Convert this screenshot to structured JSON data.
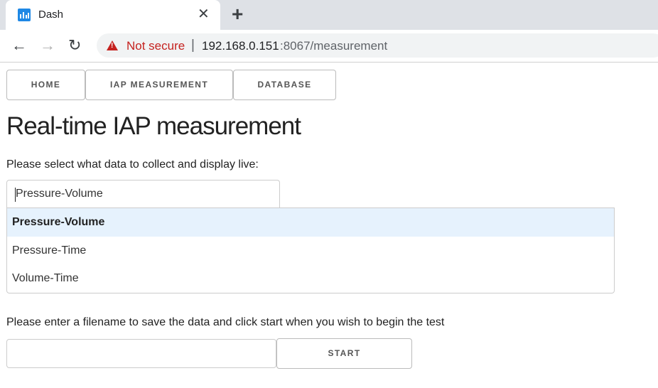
{
  "browser": {
    "tab_title": "Dash",
    "tab_close": "✕",
    "new_tab": "+",
    "security_label": "Not secure",
    "url_separator": "|",
    "url_host": "192.168.0.151",
    "url_rest": ":8067/measurement"
  },
  "nav": {
    "home": "HOME",
    "iap_measurement": "IAP MEASUREMENT",
    "database": "DATABASE"
  },
  "page": {
    "title": "Real-time IAP measurement",
    "select_prompt": "Please select what data to collect and display live:",
    "select_value": "Pressure-Volume",
    "options": [
      "Pressure-Volume",
      "Pressure-Time",
      "Volume-Time"
    ],
    "filename_prompt": "Please enter a filename to save the data and click start when you wish to begin the test",
    "filename_value": "",
    "start_label": "START"
  },
  "icons": {
    "favicon": "bar-chart-icon",
    "back": "arrow-left-icon",
    "forward": "arrow-right-icon",
    "reload": "reload-icon",
    "warning": "warning-triangle-icon"
  },
  "colors": {
    "warning": "#c5221f",
    "highlight": "#e6f2fd",
    "favicon": "#1e88e5"
  }
}
